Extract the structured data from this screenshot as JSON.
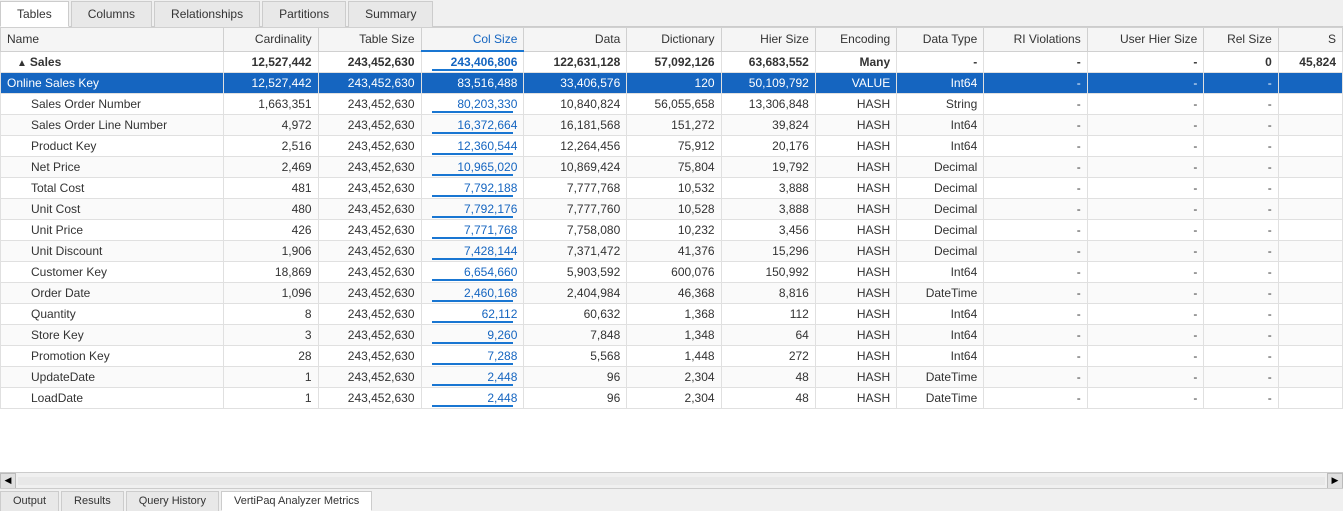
{
  "tabs": [
    {
      "label": "Tables",
      "active": true
    },
    {
      "label": "Columns",
      "active": false
    },
    {
      "label": "Relationships",
      "active": false
    },
    {
      "label": "Partitions",
      "active": false
    },
    {
      "label": "Summary",
      "active": false
    }
  ],
  "columns": [
    {
      "key": "name",
      "label": "Name",
      "highlight": false
    },
    {
      "key": "cardinality",
      "label": "Cardinality",
      "highlight": false
    },
    {
      "key": "table_size",
      "label": "Table Size",
      "highlight": false
    },
    {
      "key": "col_size",
      "label": "Col Size",
      "highlight": true
    },
    {
      "key": "data",
      "label": "Data",
      "highlight": false
    },
    {
      "key": "dictionary",
      "label": "Dictionary",
      "highlight": false
    },
    {
      "key": "hier_size",
      "label": "Hier Size",
      "highlight": false
    },
    {
      "key": "encoding",
      "label": "Encoding",
      "highlight": false
    },
    {
      "key": "data_type",
      "label": "Data Type",
      "highlight": false
    },
    {
      "key": "ri_violations",
      "label": "RI Violations",
      "highlight": false
    },
    {
      "key": "user_hier_size",
      "label": "User Hier Size",
      "highlight": false
    },
    {
      "key": "rel_size",
      "label": "Rel Size",
      "highlight": false
    },
    {
      "key": "s",
      "label": "S",
      "highlight": false
    }
  ],
  "summary_row": {
    "name": "Sales",
    "cardinality": "12,527,442",
    "table_size": "243,452,630",
    "col_size": "243,406,806",
    "data": "122,631,128",
    "dictionary": "57,092,126",
    "hier_size": "63,683,552",
    "encoding": "Many",
    "data_type": "-",
    "ri_violations": "-",
    "user_hier_size": "-",
    "rel_size": "0",
    "s": "45,824"
  },
  "rows": [
    {
      "name": "Online Sales Key",
      "cardinality": "12,527,442",
      "table_size": "243,452,630",
      "col_size": "83,516,488",
      "data": "33,406,576",
      "dictionary": "120",
      "hier_size": "50,109,792",
      "encoding": "VALUE",
      "data_type": "Int64",
      "ri_violations": "-",
      "user_hier_size": "-",
      "rel_size": "-",
      "s": "",
      "selected": true
    },
    {
      "name": "Sales Order Number",
      "cardinality": "1,663,351",
      "table_size": "243,452,630",
      "col_size": "80,203,330",
      "data": "10,840,824",
      "dictionary": "56,055,658",
      "hier_size": "13,306,848",
      "encoding": "HASH",
      "data_type": "String",
      "ri_violations": "-",
      "user_hier_size": "-",
      "rel_size": "-",
      "s": ""
    },
    {
      "name": "Sales Order Line Number",
      "cardinality": "4,972",
      "table_size": "243,452,630",
      "col_size": "16,372,664",
      "data": "16,181,568",
      "dictionary": "151,272",
      "hier_size": "39,824",
      "encoding": "HASH",
      "data_type": "Int64",
      "ri_violations": "-",
      "user_hier_size": "-",
      "rel_size": "-",
      "s": ""
    },
    {
      "name": "Product Key",
      "cardinality": "2,516",
      "table_size": "243,452,630",
      "col_size": "12,360,544",
      "data": "12,264,456",
      "dictionary": "75,912",
      "hier_size": "20,176",
      "encoding": "HASH",
      "data_type": "Int64",
      "ri_violations": "-",
      "user_hier_size": "-",
      "rel_size": "-",
      "s": ""
    },
    {
      "name": "Net Price",
      "cardinality": "2,469",
      "table_size": "243,452,630",
      "col_size": "10,965,020",
      "data": "10,869,424",
      "dictionary": "75,804",
      "hier_size": "19,792",
      "encoding": "HASH",
      "data_type": "Decimal",
      "ri_violations": "-",
      "user_hier_size": "-",
      "rel_size": "-",
      "s": ""
    },
    {
      "name": "Total Cost",
      "cardinality": "481",
      "table_size": "243,452,630",
      "col_size": "7,792,188",
      "data": "7,777,768",
      "dictionary": "10,532",
      "hier_size": "3,888",
      "encoding": "HASH",
      "data_type": "Decimal",
      "ri_violations": "-",
      "user_hier_size": "-",
      "rel_size": "-",
      "s": ""
    },
    {
      "name": "Unit Cost",
      "cardinality": "480",
      "table_size": "243,452,630",
      "col_size": "7,792,176",
      "data": "7,777,760",
      "dictionary": "10,528",
      "hier_size": "3,888",
      "encoding": "HASH",
      "data_type": "Decimal",
      "ri_violations": "-",
      "user_hier_size": "-",
      "rel_size": "-",
      "s": ""
    },
    {
      "name": "Unit Price",
      "cardinality": "426",
      "table_size": "243,452,630",
      "col_size": "7,771,768",
      "data": "7,758,080",
      "dictionary": "10,232",
      "hier_size": "3,456",
      "encoding": "HASH",
      "data_type": "Decimal",
      "ri_violations": "-",
      "user_hier_size": "-",
      "rel_size": "-",
      "s": ""
    },
    {
      "name": "Unit Discount",
      "cardinality": "1,906",
      "table_size": "243,452,630",
      "col_size": "7,428,144",
      "data": "7,371,472",
      "dictionary": "41,376",
      "hier_size": "15,296",
      "encoding": "HASH",
      "data_type": "Decimal",
      "ri_violations": "-",
      "user_hier_size": "-",
      "rel_size": "-",
      "s": ""
    },
    {
      "name": "Customer Key",
      "cardinality": "18,869",
      "table_size": "243,452,630",
      "col_size": "6,654,660",
      "data": "5,903,592",
      "dictionary": "600,076",
      "hier_size": "150,992",
      "encoding": "HASH",
      "data_type": "Int64",
      "ri_violations": "-",
      "user_hier_size": "-",
      "rel_size": "-",
      "s": ""
    },
    {
      "name": "Order Date",
      "cardinality": "1,096",
      "table_size": "243,452,630",
      "col_size": "2,460,168",
      "data": "2,404,984",
      "dictionary": "46,368",
      "hier_size": "8,816",
      "encoding": "HASH",
      "data_type": "DateTime",
      "ri_violations": "-",
      "user_hier_size": "-",
      "rel_size": "-",
      "s": ""
    },
    {
      "name": "Quantity",
      "cardinality": "8",
      "table_size": "243,452,630",
      "col_size": "62,112",
      "data": "60,632",
      "dictionary": "1,368",
      "hier_size": "112",
      "encoding": "HASH",
      "data_type": "Int64",
      "ri_violations": "-",
      "user_hier_size": "-",
      "rel_size": "-",
      "s": ""
    },
    {
      "name": "Store Key",
      "cardinality": "3",
      "table_size": "243,452,630",
      "col_size": "9,260",
      "data": "7,848",
      "dictionary": "1,348",
      "hier_size": "64",
      "encoding": "HASH",
      "data_type": "Int64",
      "ri_violations": "-",
      "user_hier_size": "-",
      "rel_size": "-",
      "s": ""
    },
    {
      "name": "Promotion Key",
      "cardinality": "28",
      "table_size": "243,452,630",
      "col_size": "7,288",
      "data": "5,568",
      "dictionary": "1,448",
      "hier_size": "272",
      "encoding": "HASH",
      "data_type": "Int64",
      "ri_violations": "-",
      "user_hier_size": "-",
      "rel_size": "-",
      "s": ""
    },
    {
      "name": "UpdateDate",
      "cardinality": "1",
      "table_size": "243,452,630",
      "col_size": "2,448",
      "data": "96",
      "dictionary": "2,304",
      "hier_size": "48",
      "encoding": "HASH",
      "data_type": "DateTime",
      "ri_violations": "-",
      "user_hier_size": "-",
      "rel_size": "-",
      "s": ""
    },
    {
      "name": "LoadDate",
      "cardinality": "1",
      "table_size": "243,452,630",
      "col_size": "2,448",
      "data": "96",
      "dictionary": "2,304",
      "hier_size": "48",
      "encoding": "HASH",
      "data_type": "DateTime",
      "ri_violations": "-",
      "user_hier_size": "-",
      "rel_size": "-",
      "s": ""
    }
  ],
  "bottom_tabs": [
    {
      "label": "Output",
      "active": false
    },
    {
      "label": "Results",
      "active": false
    },
    {
      "label": "Query History",
      "active": false
    },
    {
      "label": "VertiPaq Analyzer Metrics",
      "active": true
    }
  ]
}
